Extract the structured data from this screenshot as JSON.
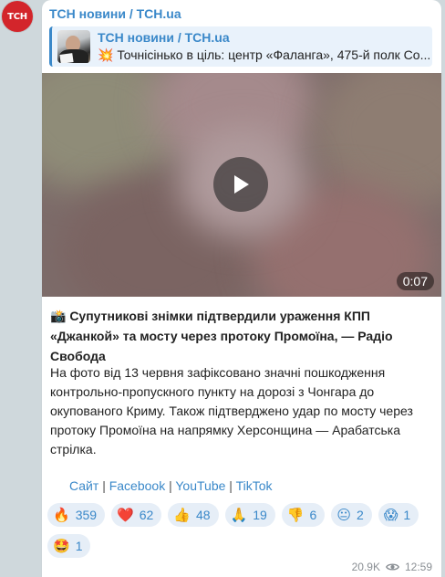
{
  "channel": {
    "name": "ТСН новини / TCH.ua",
    "avatar_text": "ТСН"
  },
  "forward": {
    "title": "ТСН новини / TCH.ua",
    "text": "💥 Точнісінько в ціль: центр «Фаланга», 475-й полк Со..."
  },
  "video": {
    "duration": "0:07"
  },
  "post": {
    "title": "📸 Супутникові знімки підтвердили ураження КПП «Джанкой» та мосту через протоку Промоїна, — Радіо Свобода",
    "body": "На фото від 13 червня зафіксовано значні пошкодження контрольно-пропускного пункту на дорозі з Чонгара до окупованого Криму. Також підтверджено удар по мосту через протоку Промоїна на напрямку Херсонщина — Арабатська стрілка."
  },
  "links": {
    "site": "Сайт",
    "facebook": "Facebook",
    "youtube": "YouTube",
    "tiktok": "TikTok",
    "separator": "|"
  },
  "reactions": [
    {
      "emoji": "🔥",
      "count": "359"
    },
    {
      "emoji": "❤️",
      "count": "62"
    },
    {
      "emoji": "👍",
      "count": "48"
    },
    {
      "emoji": "🙏",
      "count": "19"
    },
    {
      "emoji": "👎",
      "count": "6"
    },
    {
      "emoji": "😐",
      "count": "2"
    },
    {
      "emoji": "😱",
      "count": "1"
    },
    {
      "emoji": "🤩",
      "count": "1"
    }
  ],
  "meta": {
    "views": "20.9K",
    "time": "12:59"
  },
  "colors": {
    "accent": "#3a88c9",
    "avatar_bg": "#d3252b",
    "chat_bg": "#cfd8dc",
    "reaction_bg": "#e6eef7"
  }
}
